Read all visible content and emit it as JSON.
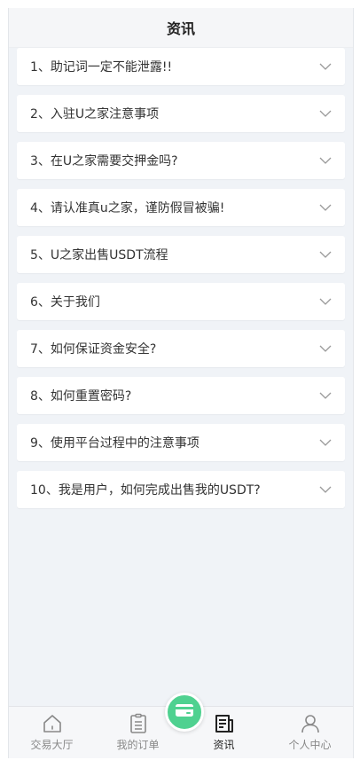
{
  "header": {
    "title": "资讯"
  },
  "items": [
    {
      "label": "1、助记词一定不能泄露!!"
    },
    {
      "label": "2、入驻U之家注意事项"
    },
    {
      "label": "3、在U之家需要交押金吗?"
    },
    {
      "label": "4、请认准真u之家，谨防假冒被骗!"
    },
    {
      "label": "5、U之家出售USDT流程"
    },
    {
      "label": "6、关于我们"
    },
    {
      "label": "7、如何保证资金安全?"
    },
    {
      "label": "8、如何重置密码?"
    },
    {
      "label": "9、使用平台过程中的注意事项"
    },
    {
      "label": "10、我是用户，如何完成出售我的USDT?"
    }
  ],
  "tabbar": {
    "tabs": [
      {
        "label": "交易大厅",
        "icon": "home-icon"
      },
      {
        "label": "我的订单",
        "icon": "clipboard-icon"
      },
      {
        "label": "资讯",
        "icon": "news-icon"
      },
      {
        "label": "个人中心",
        "icon": "user-icon"
      }
    ],
    "active_index": 2,
    "center_button_icon": "wallet-card-icon",
    "center_button_color": "#4fd190"
  },
  "colors": {
    "background": "#f0f3f7",
    "card": "#ffffff",
    "accent": "#4fd190",
    "inactive_tab": "#888888",
    "active_tab": "#222222"
  }
}
